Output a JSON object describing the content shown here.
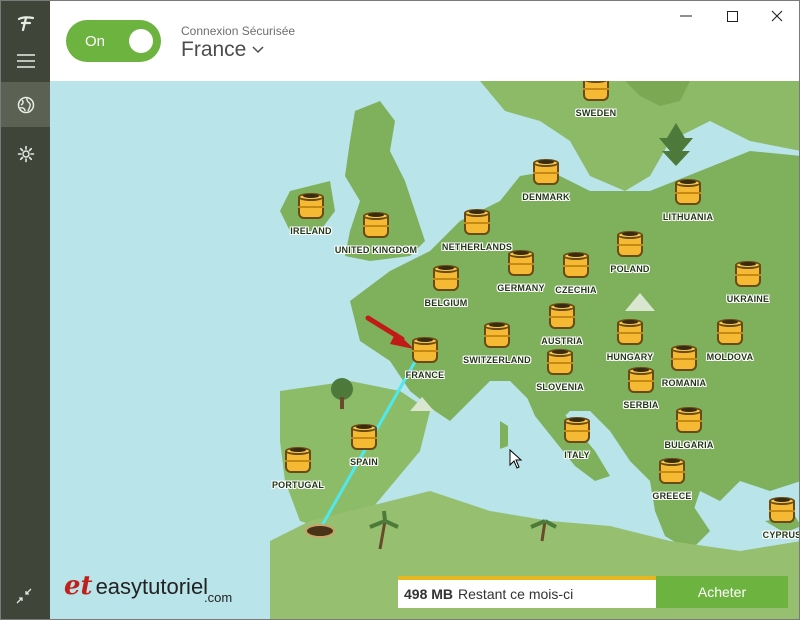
{
  "header": {
    "toggle_label": "On",
    "connection_status": "Connexion Sécurisée",
    "selected_country": "France"
  },
  "window": {
    "minimize": "—",
    "maximize": "☐",
    "close": "✕"
  },
  "map": {
    "markers": [
      {
        "label": "SWEDEN"
      },
      {
        "label": "DENMARK"
      },
      {
        "label": "LITHUANIA"
      },
      {
        "label": "IRELAND"
      },
      {
        "label": "UNITED KINGDOM"
      },
      {
        "label": "NETHERLANDS"
      },
      {
        "label": "GERMANY"
      },
      {
        "label": "CZECHIA"
      },
      {
        "label": "POLAND"
      },
      {
        "label": "UKRAINE"
      },
      {
        "label": "BELGIUM"
      },
      {
        "label": "FRANCE"
      },
      {
        "label": "SWITZERLAND"
      },
      {
        "label": "AUSTRIA"
      },
      {
        "label": "SLOVENIA"
      },
      {
        "label": "HUNGARY"
      },
      {
        "label": "MOLDOVA"
      },
      {
        "label": "ROMANIA"
      },
      {
        "label": "SERBIA"
      },
      {
        "label": "ITALY"
      },
      {
        "label": "BULGARIA"
      },
      {
        "label": "GREECE"
      },
      {
        "label": "SPAIN"
      },
      {
        "label": "PORTUGAL"
      },
      {
        "label": "CYPRUS"
      }
    ]
  },
  "logo": {
    "mark": "et",
    "text": "easytutoriel",
    "suffix": ".com"
  },
  "footer": {
    "data_amount": "498 MB",
    "data_remaining": "Restant ce mois-ci",
    "buy_label": "Acheter"
  },
  "colors": {
    "sidebar": "#3f4539",
    "accent": "#6db33f",
    "sea": "#b9e4e9",
    "land": "#7fb05c",
    "bar_top": "#e8b71f"
  }
}
